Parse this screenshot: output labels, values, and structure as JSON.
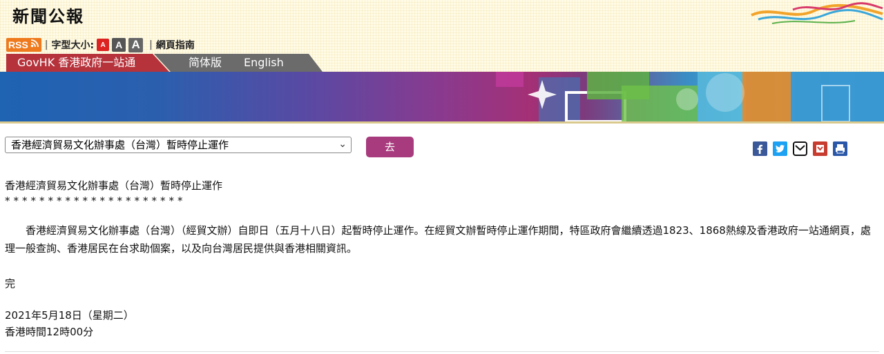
{
  "header": {
    "title": "新聞公報",
    "rss_label": "RSS",
    "font_size_label": "字型大小:",
    "font_buttons": [
      "A",
      "A",
      "A"
    ],
    "web_guide": "網頁指南"
  },
  "nav": {
    "govhk": "GovHK 香港政府一站通",
    "simplified": "简体版",
    "english": "English"
  },
  "article_select": {
    "selected": "香港經濟貿易文化辦事處（台灣）暫時停止運作",
    "go_label": "去"
  },
  "share_icons": [
    "facebook-icon",
    "twitter-icon",
    "email-icon",
    "bookmark-icon",
    "print-icon"
  ],
  "article": {
    "headline": "香港經濟貿易文化辦事處（台灣）暫時停止運作",
    "underline": "*********************",
    "body": "香港經濟貿易文化辦事處（台灣）（經貿文辦）自即日（五月十八日）起暫時停止運作。在經貿文辦暫時停止運作期間，特區政府會繼續透過1823、1868熱線及香港政府一站通網頁，處理一般查詢、香港居民在台求助個案，以及向台灣居民提供與香港相關資訊。",
    "end": "完",
    "date": "2021年5月18日（星期二）",
    "time": "香港時間12時00分"
  },
  "colors": {
    "go_button": "#a83b7d",
    "govhk_tab": "#b6333c",
    "rss": "#ee7a1d"
  }
}
